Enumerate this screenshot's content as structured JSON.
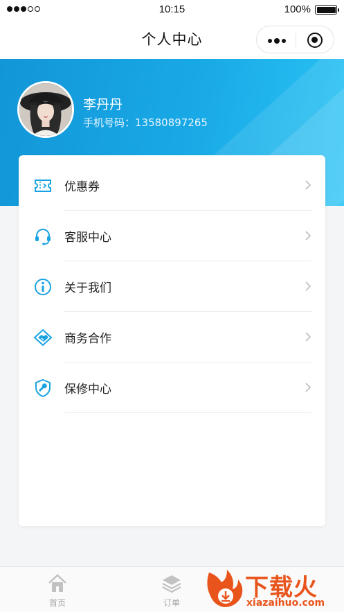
{
  "status_bar": {
    "time": "10:15",
    "battery": "100%",
    "signal_icon": "signal-dots-icon",
    "battery_icon": "battery-full-icon"
  },
  "nav": {
    "title": "个人中心",
    "more_icon": "more-dots-icon",
    "close_icon": "target-circle-icon"
  },
  "profile": {
    "name": "李丹丹",
    "phone": "手机号码：13580897265",
    "avatar_icon": "avatar-photo"
  },
  "colors": {
    "accent": "#1aa3e2",
    "banner_start": "#1296d8",
    "banner_end": "#2ac3f4",
    "tab_inactive": "#a5a5a5"
  },
  "menu": {
    "items": [
      {
        "label": "优惠券",
        "icon": "ticket-icon"
      },
      {
        "label": "客服中心",
        "icon": "headset-icon"
      },
      {
        "label": "关于我们",
        "icon": "info-icon"
      },
      {
        "label": "商务合作",
        "icon": "handshake-icon"
      },
      {
        "label": "保修中心",
        "icon": "shield-wrench-icon"
      }
    ]
  },
  "tabbar": {
    "items": [
      {
        "label": "首页",
        "icon": "home-icon"
      },
      {
        "label": "订单",
        "icon": "layers-icon"
      }
    ]
  },
  "watermark": {
    "text": "下载火",
    "url": "xiazaihuo.com"
  }
}
